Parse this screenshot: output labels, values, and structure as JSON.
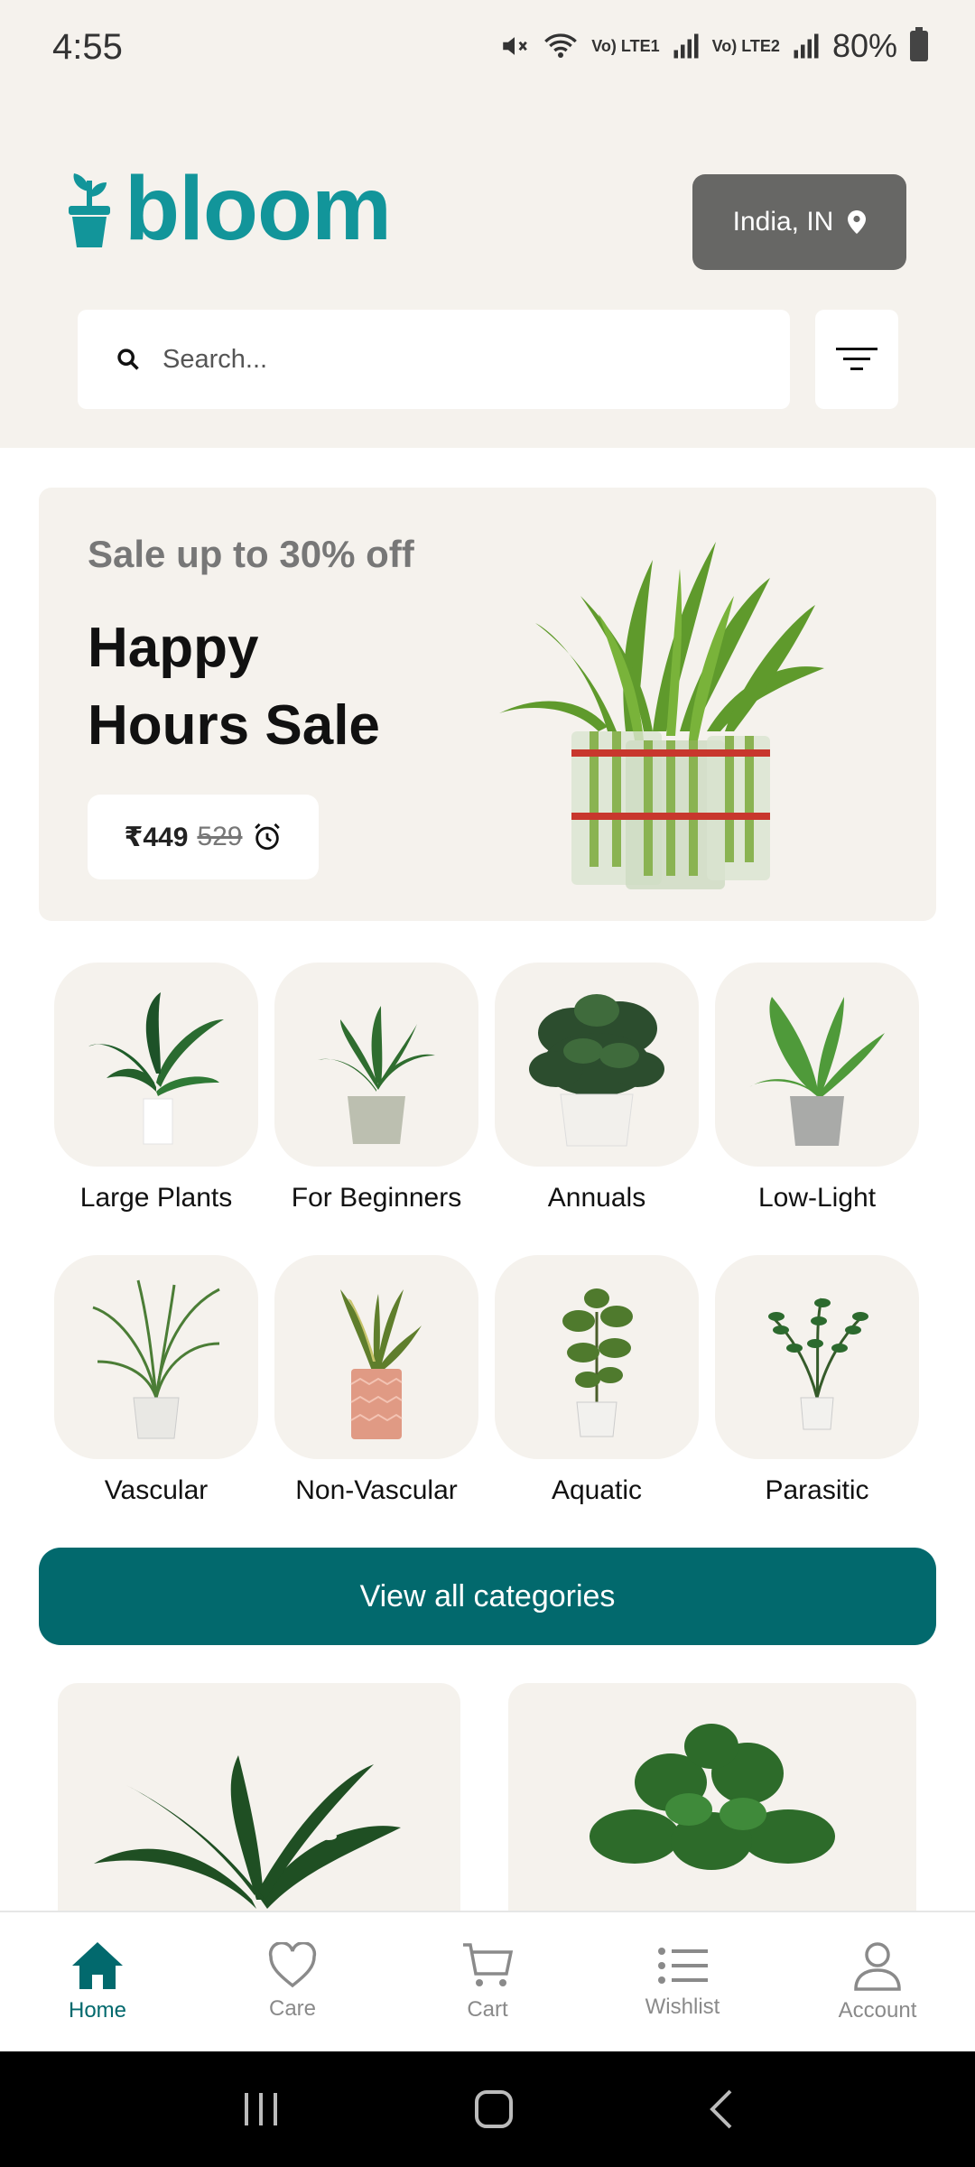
{
  "status_bar": {
    "time": "4:55",
    "battery": "80%",
    "sim1": "Vo) LTE1",
    "sim2": "Vo) LTE2"
  },
  "header": {
    "brand": "bloom",
    "location_label": "India, IN",
    "search_placeholder": "Search..."
  },
  "banner": {
    "subtitle": "Sale up to 30% off",
    "title_line1": "Happy",
    "title_line2": "Hours Sale",
    "price": "₹449",
    "old_price": "529"
  },
  "categories": [
    {
      "label": "Large Plants"
    },
    {
      "label": "For Beginners"
    },
    {
      "label": "Annuals"
    },
    {
      "label": "Low-Light"
    },
    {
      "label": "Vascular"
    },
    {
      "label": "Non-Vascular"
    },
    {
      "label": "Aquatic"
    },
    {
      "label": "Parasitic"
    }
  ],
  "view_all_label": "View all categories",
  "nav": [
    {
      "label": "Home",
      "icon": "home-icon",
      "active": true
    },
    {
      "label": "Care",
      "icon": "heart-icon"
    },
    {
      "label": "Cart",
      "icon": "cart-icon"
    },
    {
      "label": "Wishlist",
      "icon": "list-icon"
    },
    {
      "label": "Account",
      "icon": "user-icon"
    }
  ],
  "colors": {
    "brand": "#12959a",
    "primary": "#02696d",
    "surface": "#f5f2ed",
    "location_btn": "#676765"
  }
}
